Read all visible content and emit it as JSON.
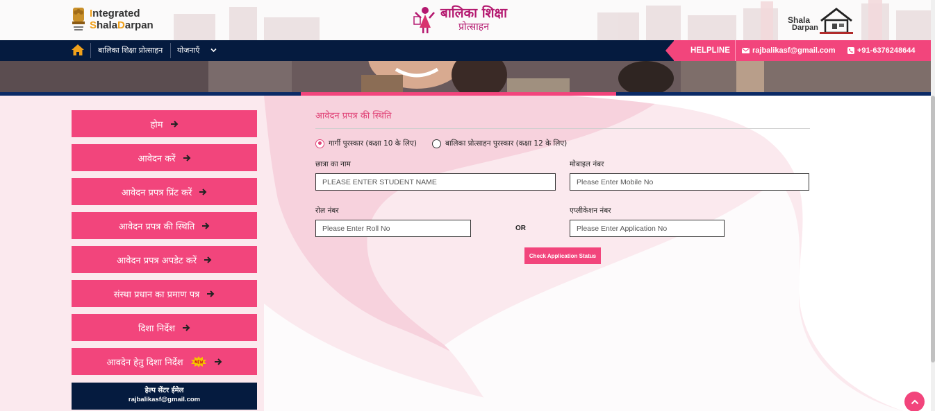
{
  "header": {
    "logo_left": {
      "line1_first": "I",
      "line1_rest": "ntegrated",
      "line2_first": "S",
      "line2_mid": "hala",
      "line2_d": "D",
      "line2_rest": "arpan"
    },
    "logo_center": {
      "title": "बालिका शिक्षा",
      "subtitle": "प्रोत्साहन"
    },
    "logo_right": {
      "line1": "Shala",
      "line2": "Darpan"
    }
  },
  "navbar": {
    "items": [
      {
        "label": "बालिका शिक्षा प्रोत्साहन"
      },
      {
        "label": "योजनाएँ"
      }
    ],
    "helpline": {
      "label": "HELPLINE",
      "email": "rajbalikasf@gmail.com",
      "phone": "+91-6376248644"
    }
  },
  "sidebar": {
    "items": [
      {
        "label": "होम"
      },
      {
        "label": "आवेदन करें"
      },
      {
        "label": "आवेदन प्रपत्र प्रिंट करें"
      },
      {
        "label": "आवेदन प्रपत्र की स्थिति"
      },
      {
        "label": "आवेदन प्रपत्र अपडेट करें"
      },
      {
        "label": "संस्था प्रधान का प्रमाण पत्र"
      },
      {
        "label": "दिशा निर्देश"
      },
      {
        "label": "आवदेन हेतु दिशा निर्देश"
      }
    ],
    "help": {
      "title": "हेल्प सेंटर ईमेल",
      "email": "rajbalikasf@gmail.com"
    }
  },
  "form": {
    "title": "आवेदन प्रपत्र की स्थिति",
    "radios": [
      {
        "label": "गार्गी पुरस्कार (कक्षा 10 के लिए)",
        "checked": true
      },
      {
        "label": "बालिका प्रोत्साहन पुरस्कार (कक्षा 12 के लिए)",
        "checked": false
      }
    ],
    "student_name": {
      "label": "छात्रा का नाम",
      "placeholder": "PLEASE ENTER STUDENT NAME",
      "value": ""
    },
    "mobile": {
      "label": "मोबाइल नंबर",
      "placeholder": "Please Enter Mobile No",
      "value": ""
    },
    "roll": {
      "label": "रोल नंबर",
      "placeholder": "Please Enter Roll No",
      "value": ""
    },
    "or_text": "OR",
    "application": {
      "label": "एप्लीकेशन नंबर",
      "placeholder": "Please Enter Application No",
      "value": ""
    },
    "submit_label": "Check Application Status"
  },
  "colors": {
    "accent": "#f2457c",
    "navy": "#051b3f",
    "title_pink": "#e04377"
  },
  "icons": [
    "home-icon",
    "chevron-down-icon",
    "mail-icon",
    "phone-icon",
    "arrow-right-icon",
    "new-badge-icon",
    "chevron-up-icon",
    "emblem-icon",
    "girl-figure-icon",
    "school-house-icon"
  ]
}
